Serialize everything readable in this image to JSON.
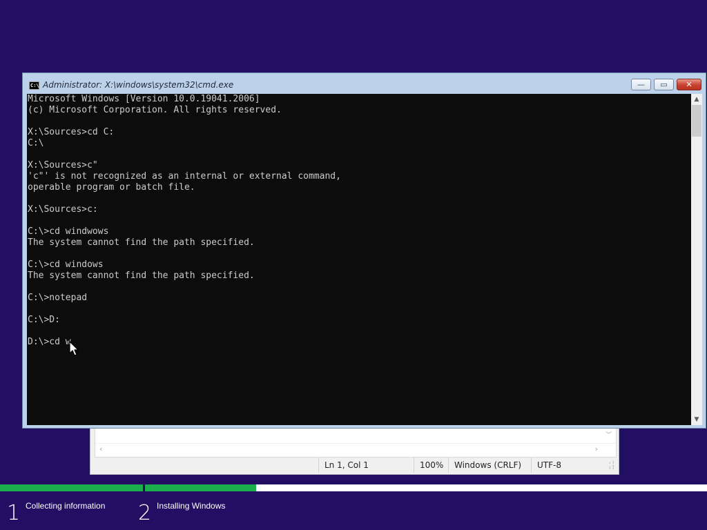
{
  "notepad": {
    "status": {
      "position": "Ln 1, Col 1",
      "zoom": "100%",
      "line_ending": "Windows (CRLF)",
      "encoding": "UTF-8"
    }
  },
  "cmd": {
    "title": "Administrator: X:\\windows\\system32\\cmd.exe",
    "icon_label": "C:\\",
    "buttons": {
      "minimize": "—",
      "maximize": "▭",
      "close": "✕"
    },
    "output": "Microsoft Windows [Version 10.0.19041.2006]\n(c) Microsoft Corporation. All rights reserved.\n\nX:\\Sources>cd C:\nC:\\\n\nX:\\Sources>c\"\n'c\"' is not recognized as an internal or external command,\noperable program or batch file.\n\nX:\\Sources>c:\n\nC:\\>cd windwows\nThe system cannot find the path specified.\n\nC:\\>cd windows\nThe system cannot find the path specified.\n\nC:\\>notepad\n\nC:\\>D:\n\nD:\\>cd w"
  },
  "setup": {
    "progress": [
      {
        "label": "Collecting information",
        "number": "1",
        "fill": 1.0
      },
      {
        "label": "Installing Windows",
        "number": "2",
        "fill": 0.198
      }
    ],
    "accent": "#1bb04b",
    "background": "#220e62"
  }
}
